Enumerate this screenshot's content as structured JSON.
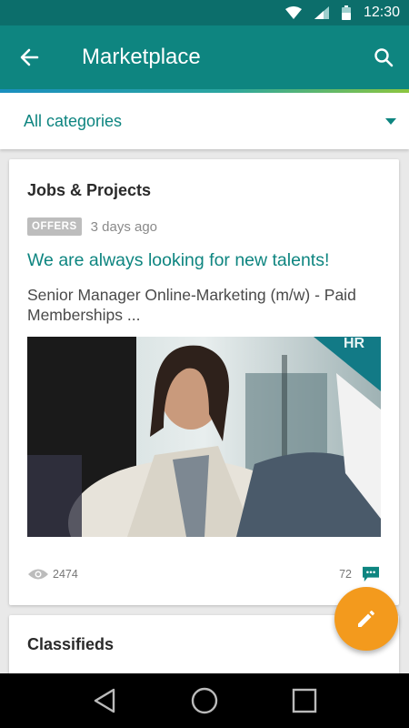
{
  "status_bar": {
    "time": "12:30",
    "icons": [
      "wifi-icon",
      "signal-icon",
      "battery-icon"
    ]
  },
  "app_bar": {
    "title": "Marketplace",
    "back_icon": "arrow-left-icon",
    "search_icon": "search-icon"
  },
  "filter": {
    "label": "All categories",
    "icon": "chevron-down-icon"
  },
  "cards": {
    "jobs": {
      "title": "Jobs & Projects",
      "badge": "OFFERS",
      "time": "3 days ago",
      "post_title": "We are always looking for new talents!",
      "post_desc": "Senior Manager Online-Marketing (m/w) - Paid Memberships  ...",
      "image_label": "HR",
      "views": "2474",
      "comments": "72"
    },
    "classifieds": {
      "title": "Classifieds"
    }
  },
  "fab": {
    "icon": "pencil-icon"
  },
  "colors": {
    "primary": "#0e8580",
    "status": "#0c6e6b",
    "accent": "#f39a1d",
    "badge": "#bdbdbd"
  }
}
